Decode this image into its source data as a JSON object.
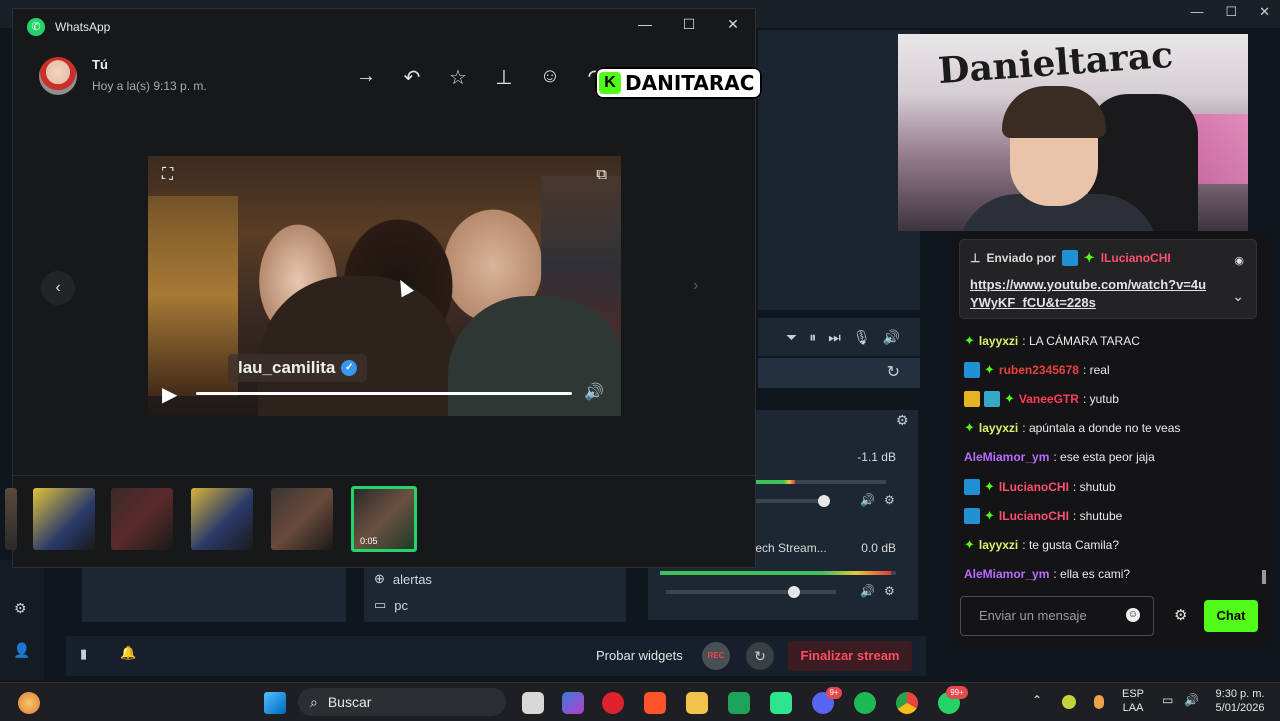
{
  "whatsapp": {
    "app_title": "WhatsApp",
    "logo_glyph": "✆",
    "window_controls": [
      "—",
      "☐",
      "✕"
    ],
    "sender": "Tú",
    "time": "Hoy a la(s) 9:13 p. m.",
    "action_icons": [
      "forward-icon",
      "reply-icon",
      "star-icon",
      "pin-icon",
      "emoji-icon",
      "share-icon"
    ],
    "action_glyphs": [
      "→",
      "↶",
      "☆",
      "⊥",
      "☺",
      "↷"
    ],
    "video": {
      "overlay_tag": "lau_camilita",
      "verified_glyph": "✓",
      "play_glyph": "▶",
      "volume_glyph": "🔊",
      "fullscreen_glyph": "⛶",
      "popout_glyph": "⧉"
    },
    "nav_prev": "‹",
    "nav_next": "›",
    "selected_thumb_duration": "0:05"
  },
  "overlay_badge": {
    "logo_letter": "K",
    "text": "DANITARAC"
  },
  "stream_app": {
    "window_controls": [
      "—",
      "☐",
      "✕"
    ],
    "sources": [
      "alertas",
      "pc"
    ],
    "source_glyphs": [
      "⊕",
      "▭"
    ],
    "mixer": [
      {
        "name": "",
        "db": "-1.1 dB",
        "level": 0.3,
        "volume": 0.95
      },
      {
        "name": "tech Stream...",
        "db": "0.0 dB",
        "level": 0.98,
        "volume": 0.75
      }
    ],
    "control_glyphs": [
      "⏷",
      "⏸",
      "⏭",
      "🎙",
      "🔊"
    ],
    "probar": "Probar widgets",
    "rec": "REC",
    "finalizar": "Finalizar stream",
    "mixer_gear": "⚙",
    "refresh": "↻",
    "sidebar_glyphs": [
      "⚙",
      "👤"
    ],
    "bottom_glyphs": [
      "▮",
      "🔔"
    ]
  },
  "chat": {
    "pinned": {
      "label": "Enviado por",
      "user": "lLucianoCHI",
      "link": "https://www.youtube.com/watch?v=4uYWyKF_fCU&t=228s"
    },
    "messages": [
      {
        "badges": [
          "star"
        ],
        "user": "layyxzi",
        "color": "#d7f26a",
        "text": ": LA CÁMARA TARAC"
      },
      {
        "badges": [
          "mod",
          "star"
        ],
        "user": "ruben2345678",
        "color": "#e8403f",
        "text": ": real"
      },
      {
        "badges": [
          "crown",
          "sub",
          "star"
        ],
        "user": "VaneeGTR",
        "color": "#ff3c5a",
        "text": ": yutub"
      },
      {
        "badges": [
          "star"
        ],
        "user": "layyxzi",
        "color": "#d7f26a",
        "text": ": apúntala a donde no te veas"
      },
      {
        "badges": [],
        "user": "AleMiamor_ym",
        "color": "#b66cff",
        "text": ": ese esta peor jaja"
      },
      {
        "badges": [
          "mod",
          "star"
        ],
        "user": "lLucianoCHI",
        "color": "#ff4f6e",
        "text": ": shutub"
      },
      {
        "badges": [
          "mod",
          "star"
        ],
        "user": "lLucianoCHI",
        "color": "#ff4f6e",
        "text": ": shutube"
      },
      {
        "badges": [
          "star"
        ],
        "user": "layyxzi",
        "color": "#d7f26a",
        "text": ": te gusta Camila?"
      },
      {
        "badges": [],
        "user": "AleMiamor_ym",
        "color": "#b66cff",
        "text": ": ella es cami?"
      }
    ],
    "input_placeholder": "Enviar un mensaje",
    "send_label": "Chat",
    "gear_glyph": "⚙",
    "smile_glyph": "☺"
  },
  "taskbar": {
    "search_label": "Buscar",
    "search_glyph": "⌕",
    "lang_top": "ESP",
    "lang_bottom": "LAA",
    "time": "9:30 p. m.",
    "date": "5/01/2026",
    "whatsapp_badge": "99+",
    "discord_badge": "9+",
    "chevron": "⌃",
    "tray_glyphs": [
      "▭",
      "🔊"
    ]
  },
  "webcam": {
    "graffiti": "Danieltarac"
  }
}
